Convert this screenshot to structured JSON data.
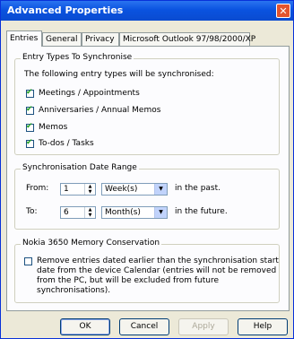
{
  "window": {
    "title": "Advanced Properties",
    "close_icon": "close-icon"
  },
  "tabs": [
    {
      "label": "Entries"
    },
    {
      "label": "General"
    },
    {
      "label": "Privacy"
    },
    {
      "label": "Microsoft Outlook 97/98/2000/XP"
    }
  ],
  "entry_types": {
    "title": "Entry Types To Synchronise",
    "intro": "The following entry types will be synchronised:",
    "items": [
      {
        "label": "Meetings / Appointments",
        "checked": true
      },
      {
        "label": "Anniversaries / Annual Memos",
        "checked": true
      },
      {
        "label": "Memos",
        "checked": true
      },
      {
        "label": "To-dos / Tasks",
        "checked": true
      }
    ]
  },
  "date_range": {
    "title": "Synchronisation Date Range",
    "from_label": "From:",
    "from_value": "1",
    "from_unit": "Week(s)",
    "from_suffix": "in the past.",
    "to_label": "To:",
    "to_value": "6",
    "to_unit": "Month(s)",
    "to_suffix": "in the future."
  },
  "memory": {
    "title": "Nokia 3650 Memory Conservation",
    "checked": false,
    "line1": "Remove entries dated earlier than the synchronisation start",
    "line2": "date from the device Calendar (entries will not be removed",
    "line3": "from the PC, but will be excluded from future",
    "line4": "synchronisations)."
  },
  "buttons": {
    "ok": "OK",
    "cancel": "Cancel",
    "apply": "Apply",
    "help": "Help"
  },
  "check_glyph": "✔"
}
